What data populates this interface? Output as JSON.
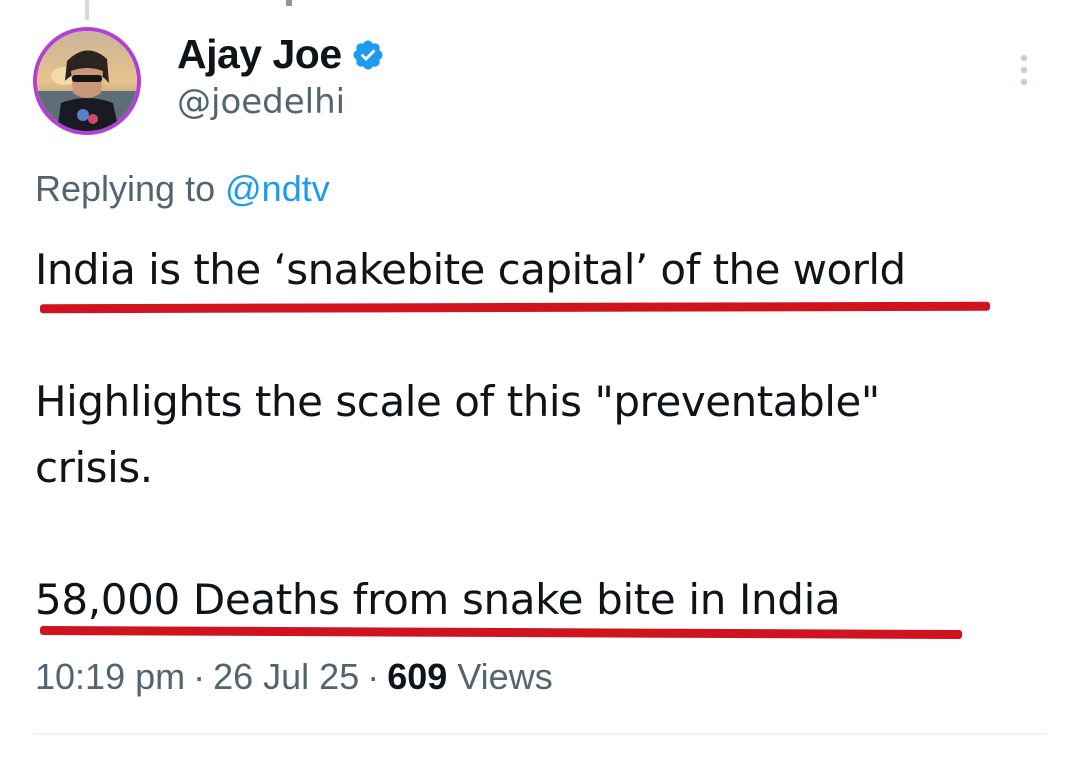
{
  "tweet": {
    "author": {
      "display_name": "Ajay Joe",
      "handle": "@joedelhi",
      "verified": true,
      "avatar_ring_color": "#b040d8"
    },
    "replying_to": {
      "label": "Replying to",
      "mention": "@ndtv"
    },
    "text_lines": [
      "India is the ‘snakebite capital’ of the world",
      "Highlights the scale of this \"preventable\"",
      "crisis.",
      "58,000 Deaths from snake bite in India"
    ],
    "meta": {
      "time": "10:19 pm",
      "separator": "·",
      "date": "26 Jul 25",
      "views_count": "609",
      "views_label": "Views"
    }
  },
  "icons": {
    "verified": "verified-badge-icon",
    "more": "more-options-icon"
  },
  "colors": {
    "link": "#1d9bf0",
    "secondary_text": "#536471",
    "primary_text": "#0f1419",
    "verified_badge": "#1d9bf0",
    "annotation_underline": "#d0141e"
  }
}
